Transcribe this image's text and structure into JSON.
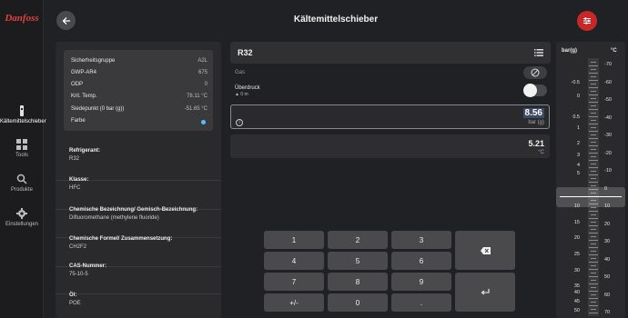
{
  "brand": "Danfoss",
  "header": {
    "title": "Kältemittelschieber"
  },
  "nav": [
    {
      "label": "Kältemittelschieber",
      "icon": "slide-rule-icon",
      "active": true
    },
    {
      "label": "Tools",
      "icon": "grid-icon"
    },
    {
      "label": "Produkte",
      "icon": "search-icon"
    },
    {
      "label": "Einstellungen",
      "icon": "gear-icon"
    }
  ],
  "properties": [
    {
      "key": "Sicherheitsgruppe",
      "value": "A2L"
    },
    {
      "key": "GWP-AR4",
      "value": "675"
    },
    {
      "key": "ODP",
      "value": "0"
    },
    {
      "key": "Krit. Temp.",
      "value": "78.11 °C"
    },
    {
      "key": "Siedepunkt (0 bar (g))",
      "value": "-51.65 °C"
    },
    {
      "key": "Farbe",
      "value": ""
    }
  ],
  "refrigerant_color": "#4fc3f7",
  "details": [
    {
      "label": "Refrigerant:",
      "value": "R32"
    },
    {
      "label": "Klasse:",
      "value": "HFC"
    },
    {
      "label": "Chemische Bezeichnung/ Gemisch-Bezeichnung:",
      "value": "Difluoromethane (methylene fluoride)"
    },
    {
      "label": "Chemische Formel/ Zusammensetzung:",
      "value": "CH2F2"
    },
    {
      "label": "CAS-Nummer:",
      "value": "75-10-5"
    },
    {
      "label": "Öl:",
      "value": "POE"
    }
  ],
  "refrigerant": {
    "name": "R32"
  },
  "gas_label": "Gas",
  "ueberdruck": {
    "label": "Überdruck",
    "sub": "0 m"
  },
  "input": {
    "value": "8.56",
    "unit": "bar (g)"
  },
  "output": {
    "value": "5.21",
    "unit": "°C"
  },
  "keypad": [
    "1",
    "2",
    "3",
    "4",
    "5",
    "6",
    "7",
    "8",
    "9",
    "+/-",
    "0",
    "."
  ],
  "scale": {
    "left_header": "bar(g)",
    "right_header": "°C",
    "left_ticks": [
      "-0.5",
      "0",
      "0.5",
      "1",
      "2",
      "3",
      "4",
      "5",
      "10",
      "15",
      "20",
      "25",
      "30",
      "35",
      "40",
      "45",
      "50"
    ],
    "right_ticks": [
      "-70",
      "-60",
      "-50",
      "-40",
      "-30",
      "-20",
      "-10",
      "0",
      "10",
      "20",
      "30",
      "40",
      "50",
      "60",
      "70"
    ]
  }
}
